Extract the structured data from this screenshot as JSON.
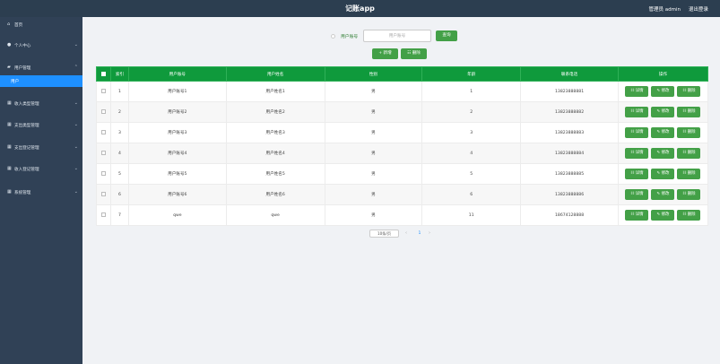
{
  "header": {
    "app_title": "记账app",
    "admin_text": "管理员 admin",
    "logout_label": "退出登录"
  },
  "sidebar": {
    "items": [
      {
        "label": "首页",
        "icon": "home-icon",
        "has_chevron": false
      },
      {
        "label": "个人中心",
        "icon": "user-icon",
        "has_chevron": true
      },
      {
        "label": "用户管理",
        "icon": "folder-icon",
        "has_chevron": true,
        "expanded": true
      },
      {
        "label": "收入类型管理",
        "icon": "grid-icon",
        "has_chevron": true
      },
      {
        "label": "支出类型管理",
        "icon": "grid-icon",
        "has_chevron": true
      },
      {
        "label": "支出登记管理",
        "icon": "grid-icon",
        "has_chevron": true
      },
      {
        "label": "收入登记管理",
        "icon": "grid-icon",
        "has_chevron": true
      },
      {
        "label": "系统管理",
        "icon": "grid-icon",
        "has_chevron": true
      }
    ],
    "active_sub_item": "用户"
  },
  "search": {
    "label": "用户账号",
    "placeholder": "用户账号",
    "button_label": "查询"
  },
  "toolbar": {
    "add_label": "+ 新增",
    "delete_label": "删除"
  },
  "table": {
    "headers": [
      "索引",
      "用户账号",
      "用户姓名",
      "性别",
      "年龄",
      "联系电话",
      "操作"
    ],
    "rows": [
      {
        "index": "1",
        "account": "用户账号1",
        "name": "用户姓名1",
        "gender": "男",
        "age": "1",
        "phone": "13823888881"
      },
      {
        "index": "2",
        "account": "用户账号2",
        "name": "用户姓名2",
        "gender": "男",
        "age": "2",
        "phone": "13823888882"
      },
      {
        "index": "3",
        "account": "用户账号3",
        "name": "用户姓名3",
        "gender": "男",
        "age": "3",
        "phone": "13823888883"
      },
      {
        "index": "4",
        "account": "用户账号4",
        "name": "用户姓名4",
        "gender": "男",
        "age": "4",
        "phone": "13823888884"
      },
      {
        "index": "5",
        "account": "用户账号5",
        "name": "用户姓名5",
        "gender": "男",
        "age": "5",
        "phone": "13823888885"
      },
      {
        "index": "6",
        "account": "用户账号6",
        "name": "用户姓名6",
        "gender": "男",
        "age": "6",
        "phone": "13823888886"
      },
      {
        "index": "7",
        "account": "qwe",
        "name": "qwe",
        "gender": "男",
        "age": "11",
        "phone": "18674128888"
      }
    ],
    "actions": {
      "detail": "详情",
      "edit": "修改",
      "delete": "删除"
    }
  },
  "pagination": {
    "page_size": "10条/页",
    "current_page": "1"
  },
  "colors": {
    "topbar": "#2c3e50",
    "sidebar": "#304156",
    "active_item": "#1e90ff",
    "header_green": "#0f9a3c",
    "button_green": "#43a047"
  }
}
